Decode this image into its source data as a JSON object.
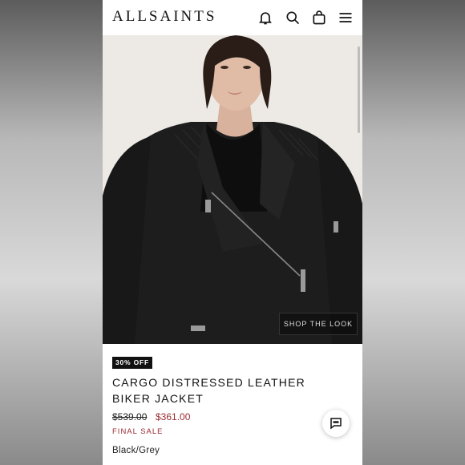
{
  "header": {
    "brand": "ALLSAINTS",
    "icons": [
      "bell-icon",
      "search-icon",
      "bag-icon",
      "menu-icon"
    ]
  },
  "hero": {
    "overlay_button": "SHOP THE LOOK"
  },
  "product": {
    "badge": "30% OFF",
    "title": "CARGO DISTRESSED LEATHER BIKER JACKET",
    "original_price": "$539.00",
    "sale_price": "$361.00",
    "sale_note": "FINAL SALE",
    "color": "Black/Grey"
  },
  "colors": {
    "accent_sale": "#9b2c32",
    "badge_bg": "#111111"
  }
}
